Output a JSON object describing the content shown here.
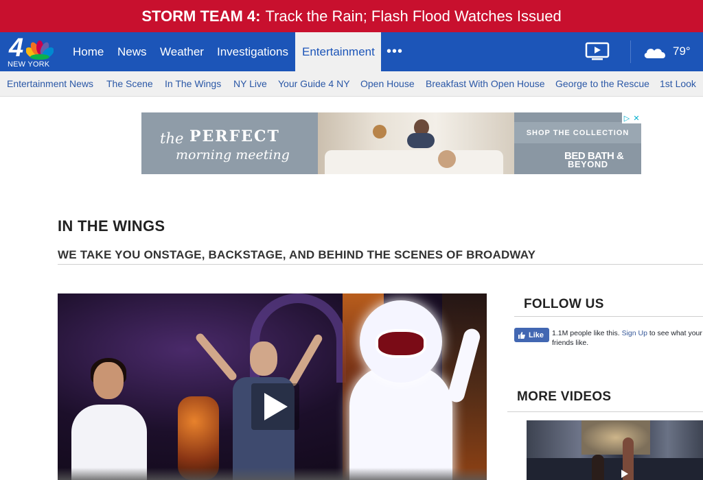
{
  "alert": {
    "label": "STORM TEAM 4:",
    "text": "Track the Rain; Flash Flood Watches Issued"
  },
  "logo": {
    "number": "4",
    "city": "NEW YORK"
  },
  "nav": {
    "items": [
      {
        "label": "Home"
      },
      {
        "label": "News"
      },
      {
        "label": "Weather"
      },
      {
        "label": "Investigations"
      },
      {
        "label": "Entertainment",
        "active": true
      }
    ],
    "more": "•••",
    "tv_icon": "tv-play-icon",
    "weather_icon": "cloud-icon",
    "temperature": "79°"
  },
  "subnav": {
    "items": [
      {
        "label": "Entertainment News"
      },
      {
        "label": "The Scene"
      },
      {
        "label": "In The Wings"
      },
      {
        "label": "NY Live"
      },
      {
        "label": "Your Guide 4 NY"
      },
      {
        "label": "Open House"
      },
      {
        "label": "Breakfast With Open House"
      },
      {
        "label": "George to the Rescue"
      },
      {
        "label": "1st Look"
      }
    ]
  },
  "ad": {
    "the": "the",
    "perfect": "PERFECT",
    "morning": "morning meeting",
    "cta": "SHOP THE COLLECTION",
    "brand_line1": "BED BATH &",
    "brand_line2": "BEYOND"
  },
  "section": {
    "title": "IN THE WINGS",
    "subtitle": "WE TAKE YOU ONSTAGE, BACKSTAGE, AND BEHIND THE SCENES OF BROADWAY"
  },
  "follow": {
    "title": "FOLLOW US",
    "like_label": "Like",
    "likes": "1.1M people like this.",
    "signup": "Sign Up",
    "rest": "to see what your friends like."
  },
  "more_videos": {
    "title": "MORE VIDEOS"
  },
  "colors": {
    "alert_red": "#c8102e",
    "nav_blue": "#1c55b8",
    "subnav_bg": "#f0f0f0",
    "link_blue": "#2a57a6",
    "facebook_blue": "#4267b2"
  }
}
